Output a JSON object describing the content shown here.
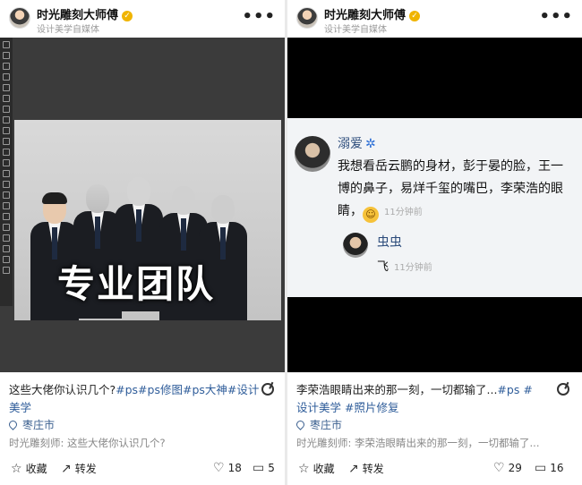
{
  "posts": [
    {
      "author": "时光雕刻大师傅",
      "author_sub": "设计美学自媒体",
      "image_caption": "专业团队",
      "title_text": "这些大佬你认识几个?",
      "tags": "#ps#ps修图#ps大神#设计美学",
      "location": "枣庄市",
      "preview": "时光雕刻师: 这些大佬你认识几个?",
      "collect_label": "收藏",
      "share_label": "转发",
      "likes": "18",
      "comments": "5"
    },
    {
      "author": "时光雕刻大师傅",
      "author_sub": "设计美学自媒体",
      "comment_user": "溺爱",
      "comment_text": "我想看岳云鹏的身材，彭于晏的脸，王一博的鼻子，易烊千玺的嘴巴，李荣浩的眼睛，",
      "comment_time": "11分钟前",
      "reply_user": "虫虫",
      "reply_text": "飞",
      "reply_time": "11分钟前",
      "title_text": "李荣浩眼睛出来的那一刻，一切都输了...",
      "tags": "#ps #设计美学 #照片修复",
      "location": "枣庄市",
      "preview": "时光雕刻师: 李荣浩眼睛出来的那一刻，一切都输了...",
      "collect_label": "收藏",
      "share_label": "转发",
      "likes": "29",
      "comments": "16"
    }
  ],
  "icons": {
    "more": "more-icon",
    "verified": "verified-badge-icon",
    "location": "location-pin-icon",
    "collect": "star-icon",
    "share": "share-arrow-icon",
    "like": "heart-icon",
    "comment": "comment-icon"
  },
  "colors": {
    "tag": "#2f5d9a",
    "badge": "#f0b400",
    "location": "#3a5f8f"
  }
}
